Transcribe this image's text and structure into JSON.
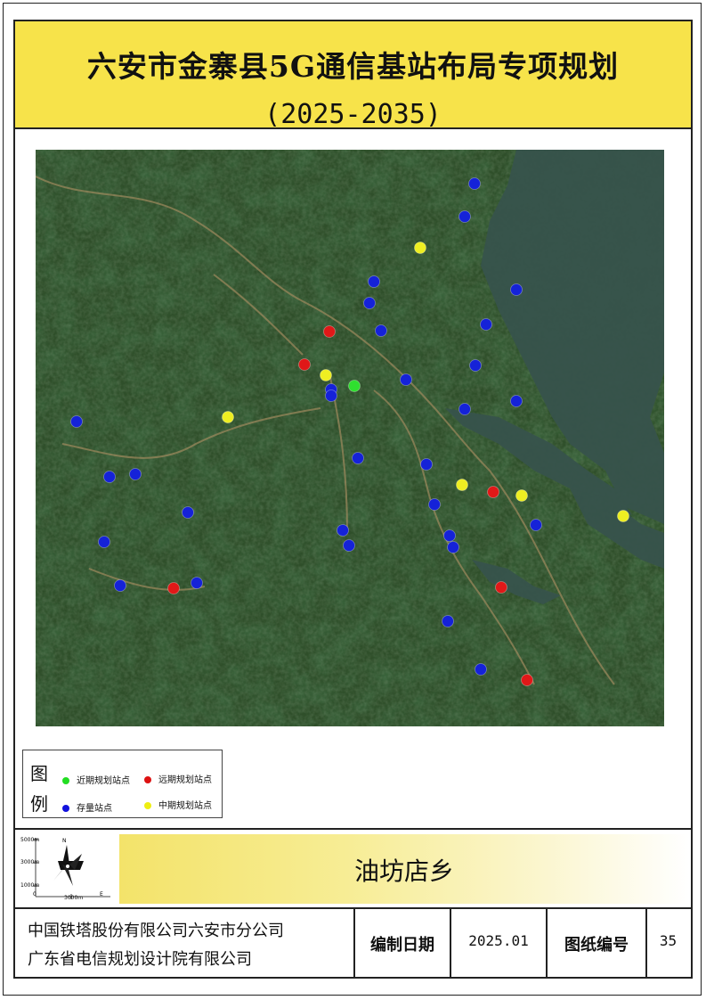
{
  "title": {
    "main": "六安市金寨县5G通信基站布局专项规划",
    "sub": "(2025-2035)"
  },
  "legend": {
    "heading_1": "图",
    "heading_2": "例",
    "items": [
      {
        "label": "近期规划站点",
        "color": "#22dd22"
      },
      {
        "label": "远期规划站点",
        "color": "#dd1111"
      },
      {
        "label": "存量站点",
        "color": "#1111dd"
      },
      {
        "label": "中期规划站点",
        "color": "#eeee11"
      }
    ]
  },
  "compass": {
    "north_label": "N",
    "scale_labels": [
      "5000m",
      "3000m",
      "1000m",
      "0",
      "3000m",
      "E"
    ]
  },
  "district": "油坊店乡",
  "footer": {
    "org_1": "中国铁塔股份有限公司六安市分公司",
    "org_2": "广东省电信规划设计院有限公司",
    "date_label": "编制日期",
    "date_value": "2025.01",
    "sheet_label": "图纸编号",
    "sheet_value": "35"
  },
  "map": {
    "sites": {
      "existing": [
        [
          533,
          206
        ],
        [
          522,
          243
        ],
        [
          420,
          316
        ],
        [
          415,
          340
        ],
        [
          428,
          371
        ],
        [
          580,
          325
        ],
        [
          546,
          364
        ],
        [
          534,
          410
        ],
        [
          456,
          426
        ],
        [
          372,
          437
        ],
        [
          372,
          444
        ],
        [
          522,
          459
        ],
        [
          580,
          450
        ],
        [
          86,
          473
        ],
        [
          402,
          514
        ],
        [
          479,
          521
        ],
        [
          152,
          532
        ],
        [
          123,
          535
        ],
        [
          488,
          566
        ],
        [
          211,
          575
        ],
        [
          602,
          589
        ],
        [
          385,
          595
        ],
        [
          392,
          612
        ],
        [
          505,
          601
        ],
        [
          509,
          614
        ],
        [
          117,
          608
        ],
        [
          221,
          654
        ],
        [
          135,
          657
        ],
        [
          503,
          697
        ],
        [
          540,
          751
        ]
      ],
      "near_term": [
        [
          398,
          433
        ]
      ],
      "long_term": [
        [
          370,
          372
        ],
        [
          342,
          409
        ],
        [
          554,
          552
        ],
        [
          195,
          660
        ],
        [
          563,
          659
        ],
        [
          592,
          763
        ]
      ],
      "mid_term": [
        [
          472,
          278
        ],
        [
          366,
          421
        ],
        [
          256,
          468
        ],
        [
          519,
          544
        ],
        [
          586,
          556
        ],
        [
          700,
          579
        ]
      ]
    }
  }
}
